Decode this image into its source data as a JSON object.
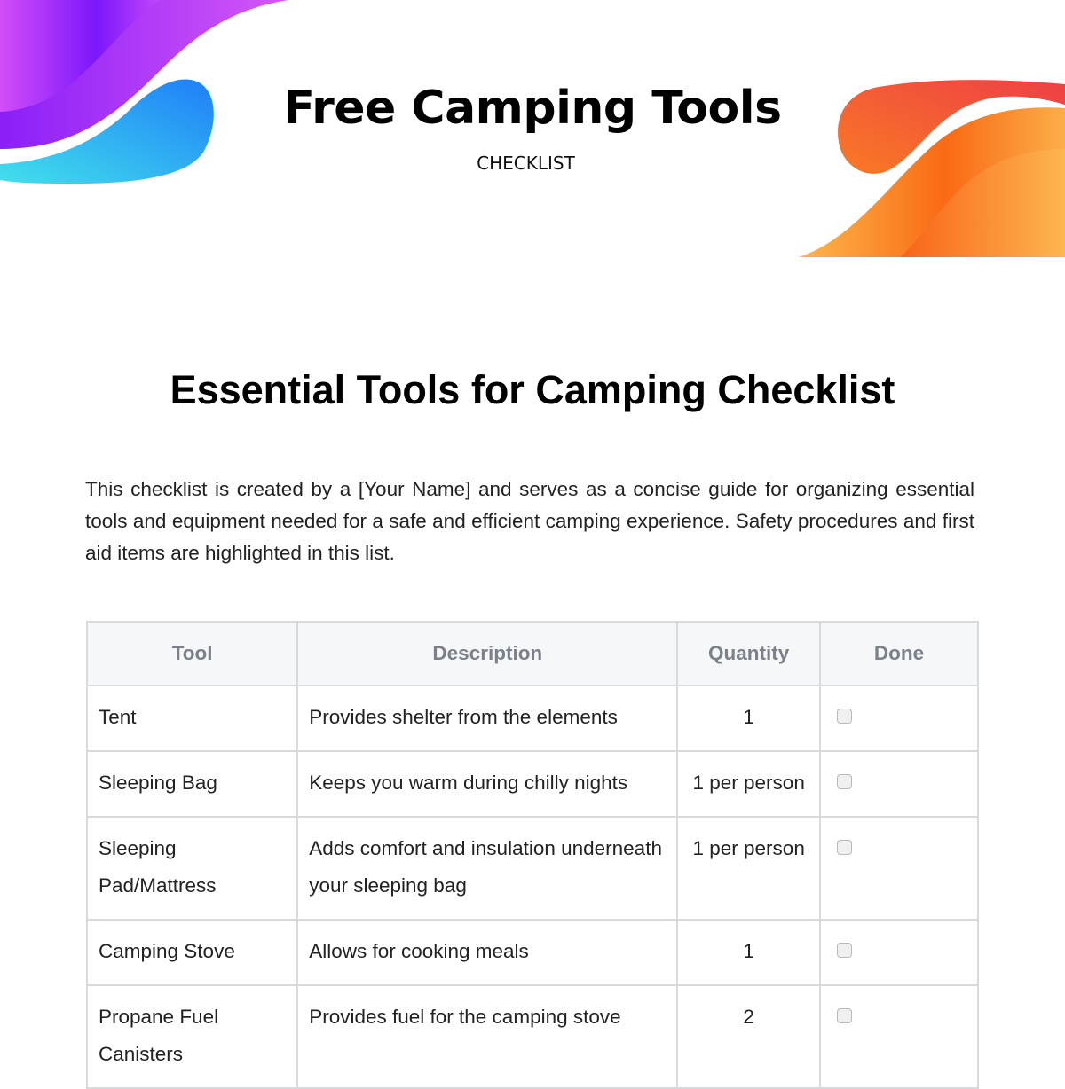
{
  "header": {
    "brand_title": "Free Camping Tools",
    "brand_subtitle": "CHECKLIST",
    "colors": {
      "wave_left_purple": "#8b1cf7",
      "wave_left_magenta": "#d04cf7",
      "wave_left_blue": "#2a8cf0",
      "wave_left_cyan": "#3fd8ec",
      "wave_right_red": "#ef4444",
      "wave_right_orange": "#f97316",
      "wave_right_yellow": "#fbb24a"
    }
  },
  "document": {
    "title": "Essential Tools for Camping Checklist",
    "intro": "This checklist is created by a [Your Name] and serves as a concise guide for organizing essential tools and equipment needed for a safe and efficient camping experience. Safety procedures and first aid items are highlighted in this list."
  },
  "table": {
    "columns": [
      "Tool",
      "Description",
      "Quantity",
      "Done"
    ],
    "rows": [
      {
        "tool": "Tent",
        "description": "Provides shelter from the elements",
        "quantity": "1",
        "done": false
      },
      {
        "tool": "Sleeping Bag",
        "description": "Keeps you warm during chilly nights",
        "quantity": "1 per person",
        "done": false
      },
      {
        "tool": "Sleeping Pad/Mattress",
        "description": "Adds comfort and insulation underneath your sleeping bag",
        "quantity": "1 per person",
        "done": false
      },
      {
        "tool": "Camping Stove",
        "description": "Allows for cooking meals",
        "quantity": "1",
        "done": false
      },
      {
        "tool": "Propane Fuel Canisters",
        "description": "Provides fuel for the camping stove",
        "quantity": "2",
        "done": false
      }
    ]
  }
}
